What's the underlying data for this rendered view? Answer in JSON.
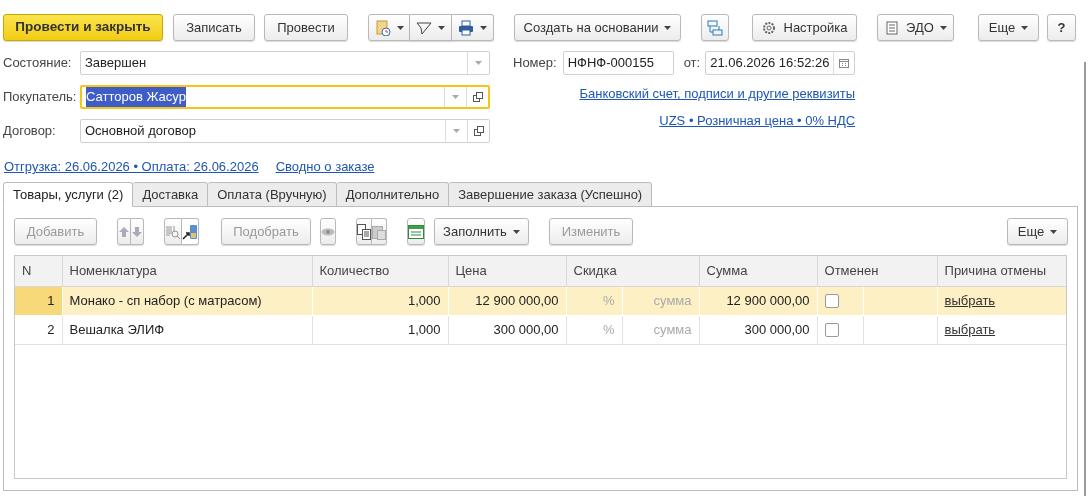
{
  "toolbar": {
    "post_close": "Провести и закрыть",
    "write": "Записать",
    "post": "Провести",
    "create_based_on": "Создать на основании",
    "settings": "Настройка",
    "edo": "ЭДО",
    "more": "Еще",
    "help": "?"
  },
  "form": {
    "state": {
      "label": "Состояние:",
      "value": "Завершен"
    },
    "buyer": {
      "label": "Покупатель:",
      "value": "Сатторов Жасур",
      "focused": true
    },
    "contract": {
      "label": "Договор:",
      "value": "Основной договор",
      "focused": false
    },
    "number": {
      "label": "Номер:",
      "value": "НФНФ-000155"
    },
    "date": {
      "label": "от:",
      "value": "21.06.2026 16:52:26"
    }
  },
  "links": {
    "bank_details": "Банковский счет, подписи и другие реквизиты",
    "currency_price": "UZS • Розничная цена • 0% НДС",
    "shipping_payment": "Отгрузка: 26.06.2026 • Оплата: 26.06.2026",
    "order_summary": "Сводно о заказе"
  },
  "tabs": [
    {
      "label": "Товары, услуги (2)",
      "selected": true
    },
    {
      "label": "Доставка",
      "selected": false
    },
    {
      "label": "Оплата (Вручную)",
      "selected": false
    },
    {
      "label": "Дополнительно",
      "selected": false
    },
    {
      "label": "Завершение заказа (Успешно)",
      "selected": false
    }
  ],
  "table_toolbar": {
    "add": {
      "label": "Добавить",
      "disabled": true
    },
    "pick": {
      "label": "Подобрать",
      "disabled": true
    },
    "fill": {
      "label": "Заполнить",
      "disabled": false
    },
    "change": {
      "label": "Изменить",
      "disabled": true
    },
    "more": {
      "label": "Еще",
      "disabled": false
    }
  },
  "table": {
    "columns": [
      "N",
      "Номенклатура",
      "Количество",
      "Цена",
      "Скидка",
      "Сумма",
      "Отменен",
      "Причина отмены"
    ],
    "rows": [
      {
        "n": "1",
        "item": "Монако - сп набор (с матрасом)",
        "quantity": "1,000",
        "price": "12 900 000,00",
        "discount_percent": "%",
        "discount_amount": "сумма",
        "sum": "12 900 000,00",
        "cancelled": false,
        "cancel_reason": "выбрать",
        "selected": true
      },
      {
        "n": "2",
        "item": "Вешалка ЭЛИФ",
        "quantity": "1,000",
        "price": "300 000,00",
        "discount_percent": "%",
        "discount_amount": "сумма",
        "sum": "300 000,00",
        "cancelled": false,
        "cancel_reason": "выбрать",
        "selected": false
      }
    ]
  }
}
